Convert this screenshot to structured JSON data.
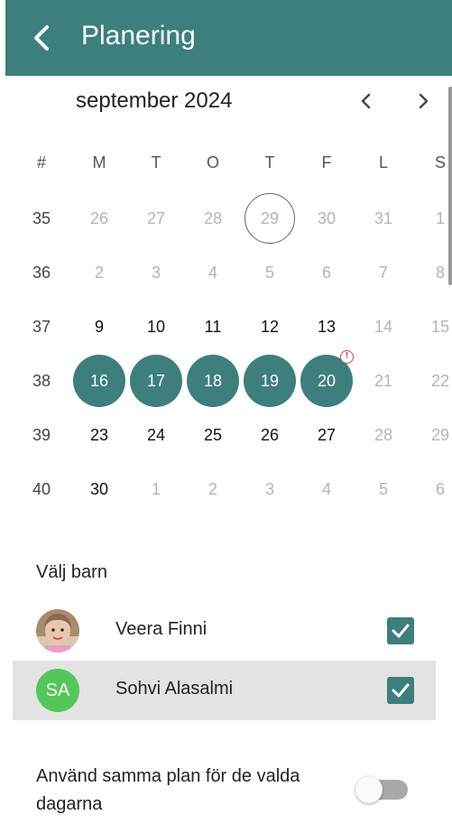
{
  "header": {
    "title": "Planering"
  },
  "calendar": {
    "month_label": "september 2024",
    "weekdays": [
      "#",
      "M",
      "T",
      "O",
      "T",
      "F",
      "L",
      "S"
    ],
    "weeks": [
      {
        "week": "35",
        "days": [
          {
            "d": "26",
            "s": "muted"
          },
          {
            "d": "27",
            "s": "muted"
          },
          {
            "d": "28",
            "s": "muted"
          },
          {
            "d": "29",
            "s": "muted today"
          },
          {
            "d": "30",
            "s": "muted"
          },
          {
            "d": "31",
            "s": "muted"
          },
          {
            "d": "1",
            "s": "muted"
          }
        ]
      },
      {
        "week": "36",
        "days": [
          {
            "d": "2",
            "s": "muted"
          },
          {
            "d": "3",
            "s": "muted"
          },
          {
            "d": "4",
            "s": "muted"
          },
          {
            "d": "5",
            "s": "muted"
          },
          {
            "d": "6",
            "s": "muted"
          },
          {
            "d": "7",
            "s": "muted"
          },
          {
            "d": "8",
            "s": "muted"
          }
        ]
      },
      {
        "week": "37",
        "days": [
          {
            "d": "9",
            "s": "active"
          },
          {
            "d": "10",
            "s": "active"
          },
          {
            "d": "11",
            "s": "active"
          },
          {
            "d": "12",
            "s": "active"
          },
          {
            "d": "13",
            "s": "active"
          },
          {
            "d": "14",
            "s": "muted"
          },
          {
            "d": "15",
            "s": "muted"
          }
        ]
      },
      {
        "week": "38",
        "days": [
          {
            "d": "16",
            "s": "sel"
          },
          {
            "d": "17",
            "s": "sel"
          },
          {
            "d": "18",
            "s": "sel"
          },
          {
            "d": "19",
            "s": "sel"
          },
          {
            "d": "20",
            "s": "sel",
            "warn": "!"
          },
          {
            "d": "21",
            "s": "muted"
          },
          {
            "d": "22",
            "s": "muted"
          }
        ]
      },
      {
        "week": "39",
        "days": [
          {
            "d": "23",
            "s": "active"
          },
          {
            "d": "24",
            "s": "active"
          },
          {
            "d": "25",
            "s": "active"
          },
          {
            "d": "26",
            "s": "active"
          },
          {
            "d": "27",
            "s": "active"
          },
          {
            "d": "28",
            "s": "muted"
          },
          {
            "d": "29",
            "s": "muted"
          }
        ]
      },
      {
        "week": "40",
        "days": [
          {
            "d": "30",
            "s": "active"
          },
          {
            "d": "1",
            "s": "muted"
          },
          {
            "d": "2",
            "s": "muted"
          },
          {
            "d": "3",
            "s": "muted"
          },
          {
            "d": "4",
            "s": "muted"
          },
          {
            "d": "5",
            "s": "muted"
          },
          {
            "d": "6",
            "s": "muted"
          }
        ]
      }
    ]
  },
  "children": {
    "label": "Välj barn",
    "items": [
      {
        "name": "Veera Finni",
        "avatar": "photo",
        "checked": true
      },
      {
        "name": "Sohvi Alasalmi",
        "avatar_initials": "SA",
        "checked": true
      }
    ]
  },
  "same_plan": {
    "label": "Använd samma plan för de valda dagarna",
    "enabled": false
  },
  "colors": {
    "accent": "#3d7f7c",
    "avatar_green": "#55c65a",
    "warning": "#d94040"
  },
  "icons": {
    "back": "chevron-left-icon",
    "prev": "chevron-left-icon",
    "next": "chevron-right-icon",
    "check": "checkmark-icon",
    "warning": "alert-circle-icon"
  }
}
